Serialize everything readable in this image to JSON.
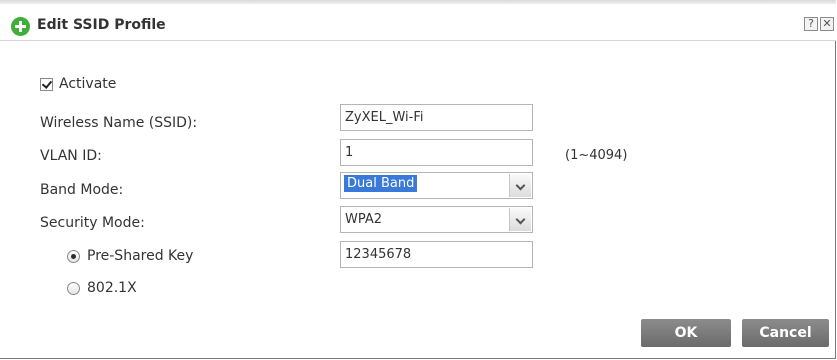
{
  "dialog": {
    "title": "Edit SSID Profile",
    "help_label": "?",
    "close_label": "✕"
  },
  "form": {
    "activate": {
      "label": "Activate",
      "checked": true
    },
    "ssid": {
      "label": "Wireless Name (SSID):",
      "value": "ZyXEL_Wi-Fi"
    },
    "vlan": {
      "label": "VLAN ID:",
      "value": "1",
      "range": "(1~4094)"
    },
    "band_mode": {
      "label": "Band Mode:",
      "value": "Dual Band"
    },
    "security_mode": {
      "label": "Security Mode:",
      "value": "WPA2"
    },
    "psk": {
      "label": "Pre-Shared Key",
      "value": "12345678",
      "selected": true
    },
    "dot1x": {
      "label": "802.1X",
      "selected": false
    }
  },
  "buttons": {
    "ok": "OK",
    "cancel": "Cancel"
  },
  "colors": {
    "accent_green": "#3faf38",
    "selection_blue": "#3879d9",
    "button_gray": "#7a7a7a"
  }
}
